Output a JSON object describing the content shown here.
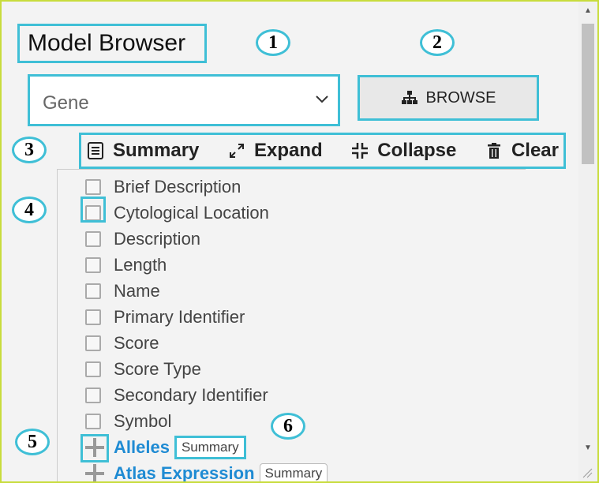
{
  "header": {
    "title": "Model Browser"
  },
  "class_select": {
    "value": "Gene"
  },
  "browse_button": {
    "label": "BROWSE"
  },
  "callouts": [
    "1",
    "2",
    "3",
    "4",
    "5",
    "6"
  ],
  "toolbar": {
    "summary": "Summary",
    "expand": "Expand",
    "collapse": "Collapse",
    "clear": "Clear"
  },
  "attributes": [
    "Brief Description",
    "Cytological Location",
    "Description",
    "Length",
    "Name",
    "Primary Identifier",
    "Score",
    "Score Type",
    "Secondary Identifier",
    "Symbol"
  ],
  "references": [
    {
      "label": "Alleles",
      "summary": "Summary"
    },
    {
      "label": "Atlas Expression",
      "summary": "Summary"
    }
  ],
  "colors": {
    "highlight": "#3fbfd6",
    "link": "#1f8bd3",
    "frame": "#c8dc3c"
  }
}
